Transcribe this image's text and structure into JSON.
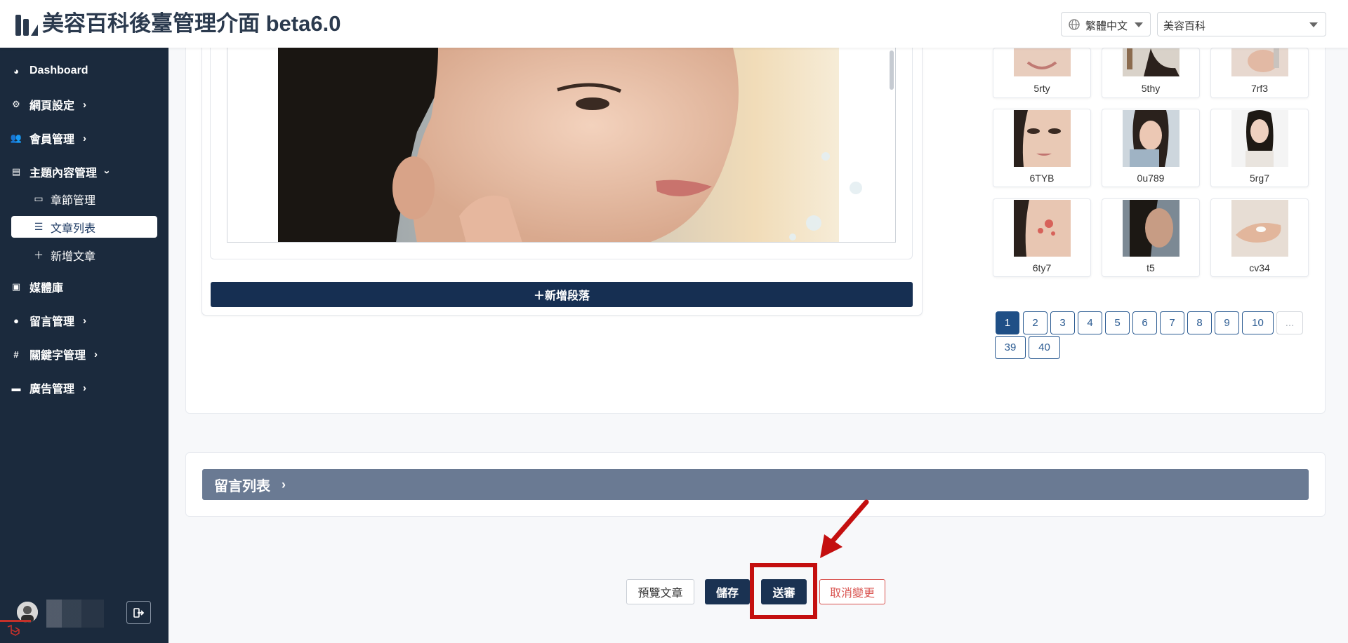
{
  "header": {
    "title": "美容百科後臺管理介面 beta6.0",
    "language": "繁體中文",
    "site": "美容百科"
  },
  "sidebar": {
    "items": [
      {
        "label": "Dashboard",
        "icon": "palette-icon"
      },
      {
        "label": "網頁設定",
        "icon": "gear-icon"
      },
      {
        "label": "會員管理",
        "icon": "users-icon"
      },
      {
        "label": "主題內容管理",
        "icon": "book-icon"
      },
      {
        "label": "媒體庫",
        "icon": "images-icon"
      },
      {
        "label": "留言管理",
        "icon": "comment-icon"
      },
      {
        "label": "關鍵字管理",
        "icon": "hashtag-icon"
      },
      {
        "label": "廣告管理",
        "icon": "ad-icon"
      }
    ],
    "subitems": [
      {
        "label": "章節管理",
        "icon": "card-icon"
      },
      {
        "label": "文章列表",
        "icon": "list-icon"
      },
      {
        "label": "新增文章",
        "icon": "plus-icon"
      }
    ]
  },
  "editor": {
    "add_paragraph_label": "＋新增段落"
  },
  "media": {
    "thumbnails": [
      "5rty",
      "5thy",
      "7rf3",
      "6TYB",
      "0u789",
      "5rg7",
      "6ty7",
      "t5",
      "cv34"
    ]
  },
  "pagination": {
    "pages": [
      "1",
      "2",
      "3",
      "4",
      "5",
      "6",
      "7",
      "8",
      "9",
      "10",
      "...",
      "39",
      "40"
    ],
    "active": "1"
  },
  "comments": {
    "header_label": "留言列表"
  },
  "actions": {
    "preview_label": "預覽文章",
    "save_label": "儲存",
    "submit_label": "送審",
    "cancel_label": "取消變更"
  },
  "colors": {
    "sidebar_bg": "#1b2a3d",
    "primary": "#162f52",
    "comments_header": "#6a7a93",
    "danger": "#d9534f",
    "highlight": "#c40f0f"
  }
}
